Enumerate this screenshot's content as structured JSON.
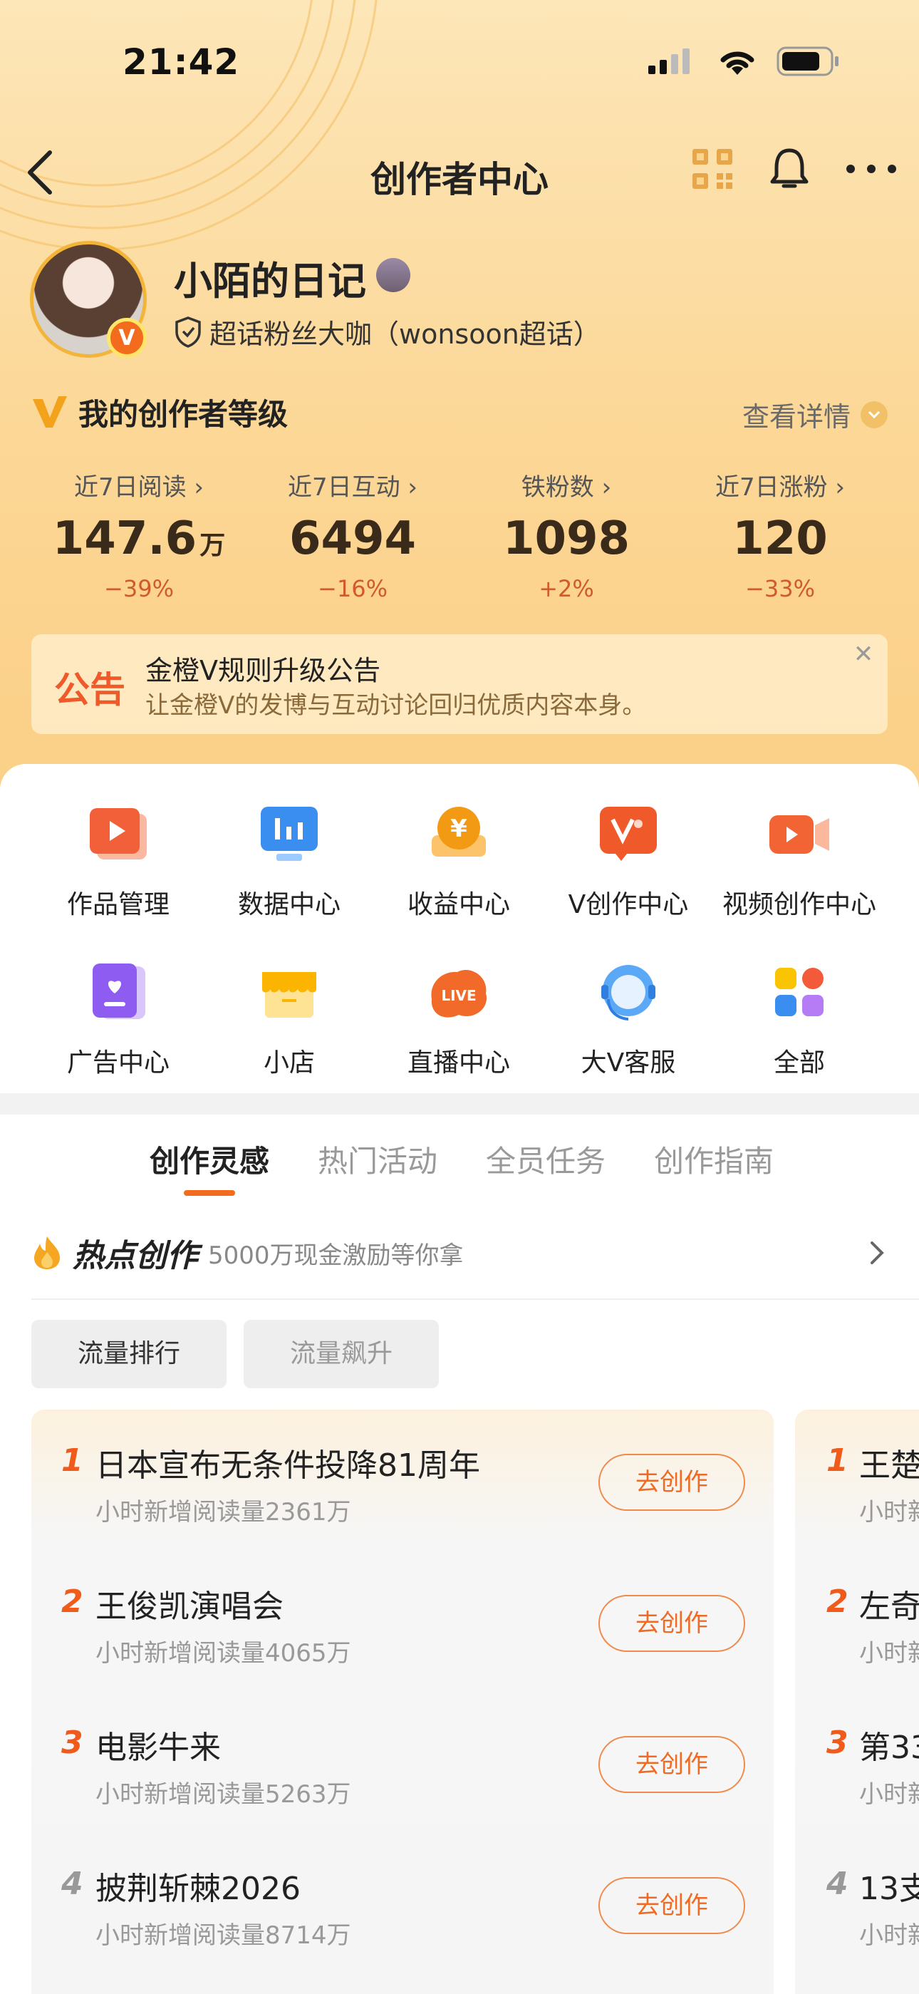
{
  "status_bar": {
    "time": "21:42"
  },
  "nav": {
    "title": "创作者中心"
  },
  "profile": {
    "name": "小陌的日记",
    "title": "超话粉丝大咖（wonsoon超话）",
    "verified_badge": "V"
  },
  "level": {
    "label": "我的创作者等级",
    "detail": "查看详情"
  },
  "stats": [
    {
      "label": "近7日阅读 ›",
      "value": "147.6",
      "unit": "万",
      "change": "−39%"
    },
    {
      "label": "近7日互动 ›",
      "value": "6494",
      "unit": "",
      "change": "−16%"
    },
    {
      "label": "铁粉数 ›",
      "value": "1098",
      "unit": "",
      "change": "+2%"
    },
    {
      "label": "近7日涨粉 ›",
      "value": "120",
      "unit": "",
      "change": "−33%"
    }
  ],
  "notice": {
    "tag": "公告",
    "title": "金橙V规则升级公告",
    "subtitle": "让金橙V的发博与互动讨论回归优质内容本身。"
  },
  "tools": [
    {
      "label": "作品管理",
      "icon": "works-icon"
    },
    {
      "label": "数据中心",
      "icon": "data-chart-icon"
    },
    {
      "label": "收益中心",
      "icon": "yuan-coin-icon"
    },
    {
      "label": "V创作中心",
      "icon": "v-create-icon"
    },
    {
      "label": "视频创作中心",
      "icon": "video-camera-icon"
    },
    {
      "label": "广告中心",
      "icon": "ad-heart-icon"
    },
    {
      "label": "小店",
      "icon": "shop-icon"
    },
    {
      "label": "直播中心",
      "icon": "live-icon"
    },
    {
      "label": "大V客服",
      "icon": "headset-icon"
    },
    {
      "label": "全部",
      "icon": "all-grid-icon"
    }
  ],
  "tabs": [
    "创作灵感",
    "热门活动",
    "全员任务",
    "创作指南"
  ],
  "hot": {
    "title": "热点创作",
    "subtitle": "5000万现金激励等你拿"
  },
  "chips": [
    "流量排行",
    "流量飙升"
  ],
  "ranking": [
    {
      "rank": "1",
      "title": "日本宣布无条件投降81周年",
      "sub": "小时新增阅读量2361万",
      "button": "去创作"
    },
    {
      "rank": "2",
      "title": "王俊凯演唱会",
      "sub": "小时新增阅读量4065万",
      "button": "去创作"
    },
    {
      "rank": "3",
      "title": "电影牛来",
      "sub": "小时新增阅读量5263万",
      "button": "去创作"
    },
    {
      "rank": "4",
      "title": "披荆斩棘2026",
      "sub": "小时新增阅读量8714万",
      "button": "去创作"
    }
  ],
  "ranking2": [
    {
      "rank": "1",
      "title": "王楚",
      "sub": "小时新"
    },
    {
      "rank": "2",
      "title": "左奇",
      "sub": "小时新"
    },
    {
      "rank": "3",
      "title": "第33",
      "sub": "小时新"
    },
    {
      "rank": "4",
      "title": "13支",
      "sub": "小时新"
    }
  ],
  "colors": {
    "accent": "#f36b1c",
    "rank_top": "#f05a1a",
    "rank_normal": "#999999"
  }
}
